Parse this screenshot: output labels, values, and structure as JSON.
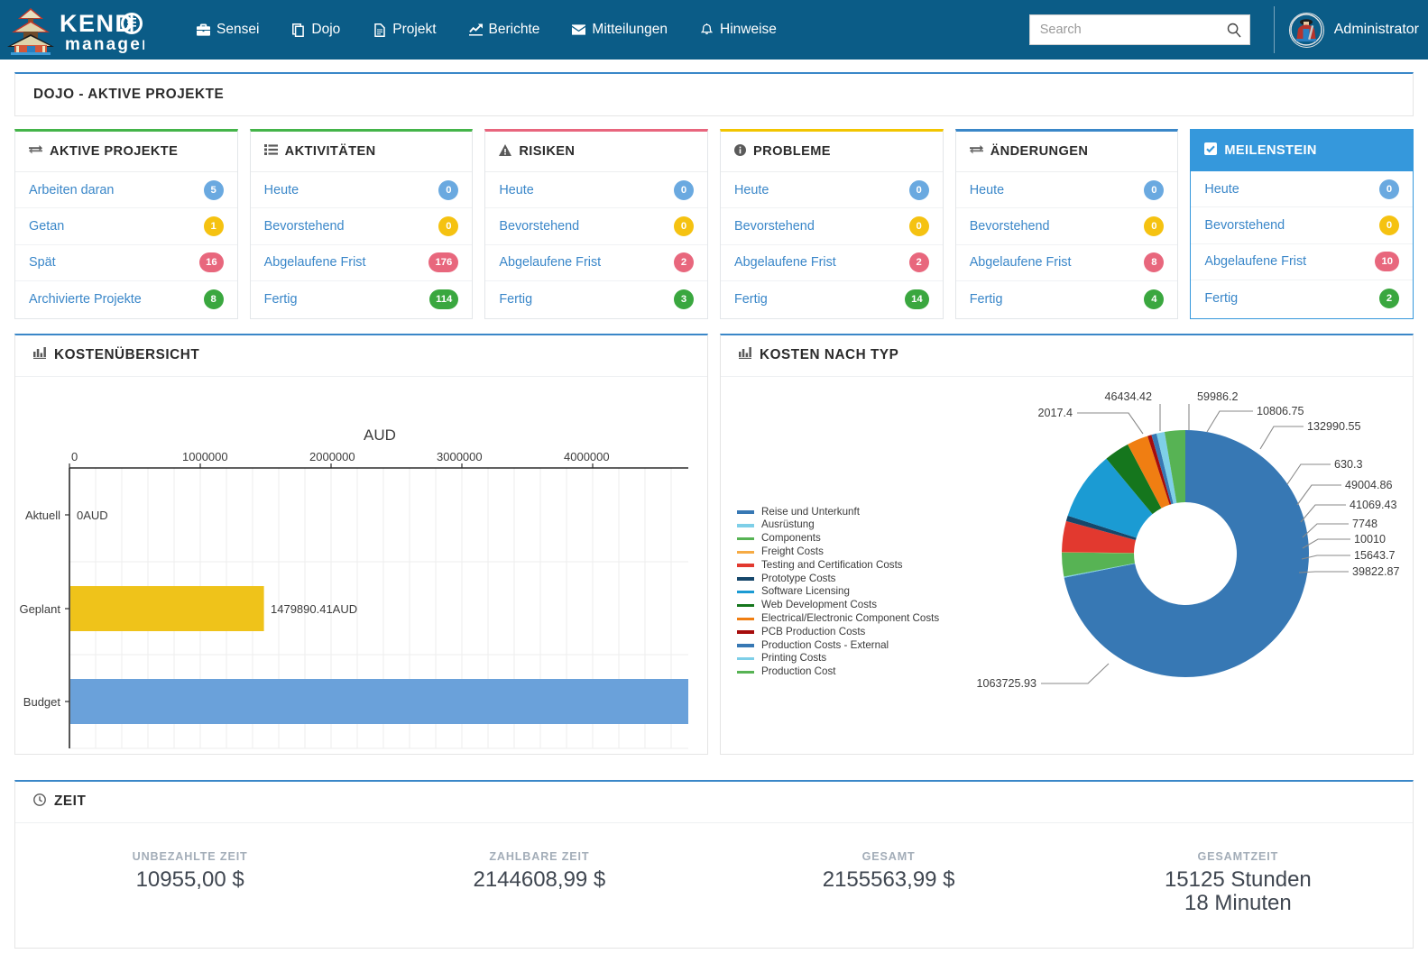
{
  "brand": {
    "name_top": "KENDO",
    "name_bottom": "manager"
  },
  "nav": {
    "items": [
      {
        "label": "Sensei",
        "icon": "briefcase-icon"
      },
      {
        "label": "Dojo",
        "icon": "copy-icon"
      },
      {
        "label": "Projekt",
        "icon": "file-icon"
      },
      {
        "label": "Berichte",
        "icon": "chart-line-icon"
      },
      {
        "label": "Mitteilungen",
        "icon": "envelope-icon"
      },
      {
        "label": "Hinweise",
        "icon": "bell-icon"
      }
    ]
  },
  "search": {
    "placeholder": "Search",
    "value": ""
  },
  "user": {
    "name": "Administrator"
  },
  "page_title": "DOJO - AKTIVE PROJEKTE",
  "cards": [
    {
      "title": "AKTIVE PROJEKTE",
      "icon": "exchange-icon",
      "accent": "#44b449",
      "active": false,
      "rows": [
        {
          "label": "Arbeiten daran",
          "value": "5",
          "color": "blue"
        },
        {
          "label": "Getan",
          "value": "1",
          "color": "yellow"
        },
        {
          "label": "Spät",
          "value": "16",
          "color": "red"
        },
        {
          "label": "Archivierte Projekte",
          "value": "8",
          "color": "green"
        }
      ]
    },
    {
      "title": "AKTIVITÄTEN",
      "icon": "tasks-icon",
      "accent": "#44b449",
      "active": false,
      "rows": [
        {
          "label": "Heute",
          "value": "0",
          "color": "blue"
        },
        {
          "label": "Bevorstehend",
          "value": "0",
          "color": "yellow"
        },
        {
          "label": "Abgelaufene Frist",
          "value": "176",
          "color": "red"
        },
        {
          "label": "Fertig",
          "value": "114",
          "color": "green"
        }
      ]
    },
    {
      "title": "RISIKEN",
      "icon": "warning-icon",
      "accent": "#e8657d",
      "active": false,
      "rows": [
        {
          "label": "Heute",
          "value": "0",
          "color": "blue"
        },
        {
          "label": "Bevorstehend",
          "value": "0",
          "color": "yellow"
        },
        {
          "label": "Abgelaufene Frist",
          "value": "2",
          "color": "red"
        },
        {
          "label": "Fertig",
          "value": "3",
          "color": "green"
        }
      ]
    },
    {
      "title": "PROBLEME",
      "icon": "info-icon",
      "accent": "#f2c500",
      "active": false,
      "rows": [
        {
          "label": "Heute",
          "value": "0",
          "color": "blue"
        },
        {
          "label": "Bevorstehend",
          "value": "0",
          "color": "yellow"
        },
        {
          "label": "Abgelaufene Frist",
          "value": "2",
          "color": "red"
        },
        {
          "label": "Fertig",
          "value": "14",
          "color": "green"
        }
      ]
    },
    {
      "title": "ÄNDERUNGEN",
      "icon": "exchange-icon",
      "accent": "#3a87c8",
      "active": false,
      "rows": [
        {
          "label": "Heute",
          "value": "0",
          "color": "blue"
        },
        {
          "label": "Bevorstehend",
          "value": "0",
          "color": "yellow"
        },
        {
          "label": "Abgelaufene Frist",
          "value": "8",
          "color": "red"
        },
        {
          "label": "Fertig",
          "value": "4",
          "color": "green"
        }
      ]
    },
    {
      "title": "MEILENSTEIN",
      "icon": "check-square-icon",
      "accent": "#3598dc",
      "active": true,
      "rows": [
        {
          "label": "Heute",
          "value": "0",
          "color": "blue"
        },
        {
          "label": "Bevorstehend",
          "value": "0",
          "color": "yellow"
        },
        {
          "label": "Abgelaufene Frist",
          "value": "10",
          "color": "red"
        },
        {
          "label": "Fertig",
          "value": "2",
          "color": "green"
        }
      ]
    }
  ],
  "cost_overview": {
    "title": "KOSTENÜBERSICHT",
    "icon": "bar-chart-icon"
  },
  "cost_by_type": {
    "title": "KOSTEN NACH TYP",
    "icon": "bar-chart-icon"
  },
  "time": {
    "title": "ZEIT",
    "icon": "clock-icon",
    "cells": [
      {
        "label": "UNBEZAHLTE ZEIT",
        "value": "10955,00 $"
      },
      {
        "label": "ZAHLBARE ZEIT",
        "value": "2144608,99 $"
      },
      {
        "label": "GESAMT",
        "value": "2155563,99 $"
      },
      {
        "label": "GESAMTZEIT",
        "value": "15125 Stunden\n18 Minuten"
      }
    ]
  },
  "chart_data": [
    {
      "type": "bar",
      "orientation": "horizontal",
      "title": "AUD",
      "xlabel": "",
      "ylabel": "",
      "categories": [
        "Aktuell",
        "Geplant",
        "Budget"
      ],
      "values": [
        0,
        1479890.41,
        4730000
      ],
      "data_labels": [
        "0AUD",
        "1479890.41AUD",
        ""
      ],
      "colors": [
        "#cccccc",
        "#efc31a",
        "#6aa1da"
      ],
      "xlim": [
        0,
        4730000
      ],
      "xticks": [
        0,
        1000000,
        2000000,
        3000000,
        4000000
      ],
      "xticklabels": [
        "0",
        "1000000",
        "2000000",
        "3000000",
        "4000000"
      ],
      "grid": true,
      "legend": "none"
    },
    {
      "type": "pie",
      "subtype": "donut",
      "title": "",
      "legend": "left",
      "labels": [
        "Reise und Unterkunft",
        "Ausrüstung",
        "Components",
        "Freight Costs",
        "Testing and Certification Costs",
        "Prototype Costs",
        "Software Licensing",
        "Web Development Costs",
        "Electrical/Electronic Component Costs",
        "PCB Production Costs",
        "Production Costs - External",
        "Printing Costs",
        "Production Cost"
      ],
      "colors": [
        "#3778b4",
        "#7ecfe8",
        "#57b354",
        "#f6ab44",
        "#e2392f",
        "#16476b",
        "#1b9bd3",
        "#15761d",
        "#f07e12",
        "#a60c0c",
        "#3778b4",
        "#7ecfe8",
        "#57b354"
      ],
      "values": [
        1063725.93,
        2017.4,
        46434.42,
        630.3,
        59986.2,
        10806.75,
        132990.55,
        49004.86,
        41069.43,
        7748,
        10010,
        15643.7,
        39822.87
      ],
      "data_labels": [
        "1063725.93",
        "2017.4",
        "46434.42",
        "630.3",
        "59986.2",
        "10806.75",
        "132990.55",
        "49004.86",
        "41069.43",
        "7748",
        "10010",
        "15643.7",
        "39822.87"
      ],
      "callout_labels": [
        "2017.4",
        "46434.42",
        "59986.2",
        "10806.75",
        "132990.55",
        "630.3",
        "49004.86",
        "41069.43",
        "7748",
        "10010",
        "15643.7",
        "39822.87",
        "1063725.93"
      ]
    }
  ]
}
